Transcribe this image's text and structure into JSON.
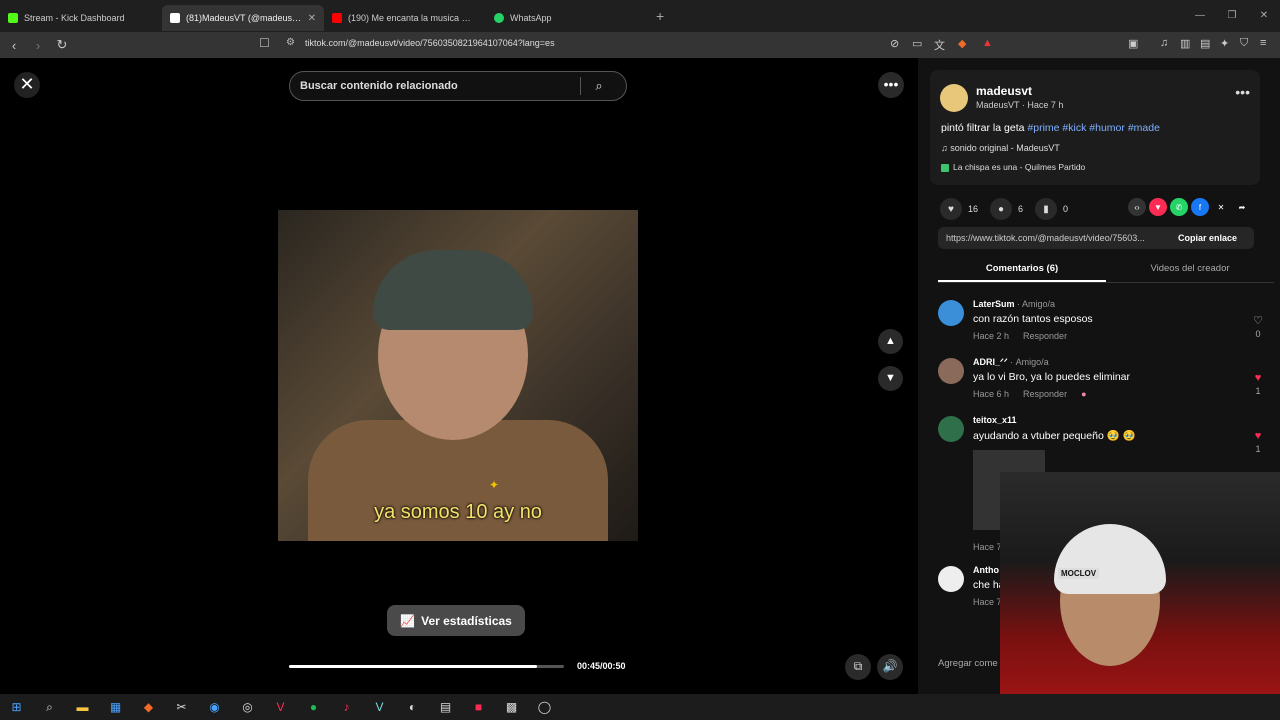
{
  "browser": {
    "tabs": [
      {
        "label": "Stream - Kick Dashboard",
        "color": "#53fc18"
      },
      {
        "label": "(81)MadeusVT (@madeusvt) |",
        "color": "#ffffff"
      },
      {
        "label": "(190) Me encanta la musica 😍 - You",
        "color": "#ff0000"
      },
      {
        "label": "WhatsApp",
        "color": "#25d366"
      }
    ],
    "url": "tiktok.com/@madeusvt/video/7560350821964107064?lang=es"
  },
  "search": {
    "placeholder": "Buscar contenido relacionado"
  },
  "video": {
    "caption": "ya somos 10 ay no",
    "stats_button": "Ver estadísticas",
    "time": "00:45/00:50",
    "progress": 0.9
  },
  "post": {
    "author": "madeusvt",
    "author_sub": "MadeusVT · Hace 7 h",
    "desc_text": "pintó filtrar la geta",
    "tags": [
      "#prime",
      "#kick",
      "#humor",
      "#made"
    ],
    "sound": "♫  sonido original - MadeusVT",
    "sound2": "La chispa es una - Quilmes Partido",
    "likes": "16",
    "comments": "6",
    "saves": "0",
    "link": "https://www.tiktok.com/@madeusvt/video/75603...",
    "copy": "Copiar enlace",
    "tab_comments": "Comentarios (6)",
    "tab_videos": "Videos del creador"
  },
  "comments": [
    {
      "name": "LaterSum",
      "friend": " · Amigo/a",
      "text": "con razón tantos esposos",
      "time": "Hace 2 h",
      "reply": "Responder",
      "likes": "0",
      "liked": false
    },
    {
      "name": "ADRI_ᐟᐟ",
      "friend": " · Amigo/a",
      "text": "ya lo vi Bro, ya lo puedes eliminar",
      "time": "Hace 6 h",
      "reply": "Responder",
      "likes": "1",
      "liked": true
    },
    {
      "name": "teitox_x11",
      "friend": "",
      "text": "ayudando a vtuber pequeño 🥹 🥹",
      "time": "",
      "reply": "",
      "likes": "1",
      "liked": true
    }
  ],
  "comment4": {
    "name": "Antho",
    "text": "che ha",
    "time": "Hace 7"
  },
  "comment3_time": "Hace 7",
  "add_comment": "Agregar come",
  "webcam_logo": "MOCLOV"
}
